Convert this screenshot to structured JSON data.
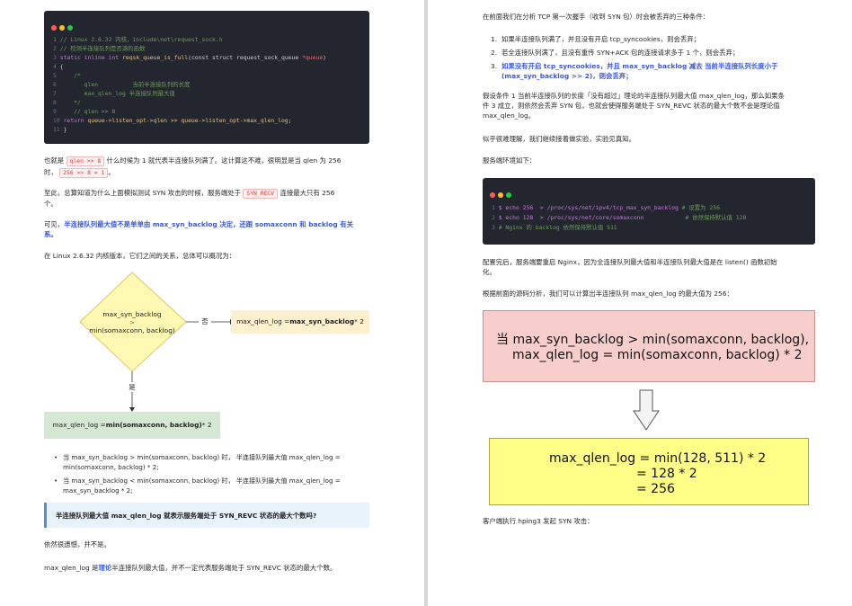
{
  "left": {
    "code": [
      {
        "n": "1",
        "text": "// Linux 2.6.32 内核，include\\net\\request_sock.h"
      },
      {
        "n": "2",
        "text": "// 检测半连接队列是否满的函数"
      },
      {
        "n": "3",
        "kw1": "static inline int",
        "fname": "reqsk_queue_is_full",
        "args_a": "(const struct request_sock_queue ",
        "args_b": "*queue",
        "args_c": ")"
      },
      {
        "n": "4",
        "text": "{"
      },
      {
        "n": "5",
        "text": "    /*"
      },
      {
        "n": "6",
        "text": "       qlen          当前半连接队列的长度"
      },
      {
        "n": "7",
        "text": "       max_qlen_log 半连接队列最大值"
      },
      {
        "n": "8",
        "text": "    */"
      },
      {
        "n": "9",
        "text": "    // qlen >> 8"
      },
      {
        "n": "10",
        "kw": "return",
        "expr": " queue->listen_opt->qlen >> queue->listen_opt->max_qlen_log;"
      },
      {
        "n": "11",
        "text": "}"
      }
    ],
    "p1_a": "也就是",
    "p1_tag1": "qlen >> 8",
    "p1_b": "什么时候为 1 就代表半连接队列满了。这计算这不难，很明显是当 qlen 为 256",
    "p1_c": "时，",
    "p1_tag2": "256 >> 8 = 1",
    "p1_d": "。",
    "p2_a": "至此，总算知道为什么上面模拟测试 SYN 攻击的时候，服务端处于",
    "p2_tag": "SYN_RECV",
    "p2_b": "连接最大只有 256",
    "p2_c": "个。",
    "p3_a": "可见，",
    "p3_b": "半连接队列最大值不是单单由 max_syn_backlog 决定，还跟 somaxconn 和 backlog 有关",
    "p3_c": "系。",
    "p4": "在 Linux 2.6.32 内核版本，它们之间的关系，总体可以概况为：",
    "flow": {
      "diamond_l1": "max_syn_backlog",
      "diamond_l2": ">",
      "diamond_l3": "min(somaxconn, backlog)",
      "no_label": "否",
      "yes_label": "是",
      "right_a": "max_qlen_log = ",
      "right_b": "max_syn_backlog",
      "right_c": " * 2",
      "bottom_a": "max_qlen_log = ",
      "bottom_b": "min(somaxconn, backlog)",
      "bottom_c": " * 2"
    },
    "bullets": [
      {
        "l1": "当 max_syn_backlog > min(somaxconn, backlog) 时， 半连接队列最大值 max_qlen_log =",
        "l2": "min(somaxconn, backlog) * 2;"
      },
      {
        "l1": "当 max_syn_backlog < min(somaxconn, backlog) 时， 半连接队列最大值 max_qlen_log =",
        "l2": "max_syn_backlog * 2;"
      }
    ],
    "callout": "半连接队列最大值 max_qlen_log 就表示服务端处于 SYN_REVC 状态的最大个数吗?",
    "p5": "依然很遗憾，并不是。",
    "p6_a": "max_qlen_log 是",
    "p6_b": "理论",
    "p6_c": "半连接队列最大值，并不一定代表服务端处于 SYN_REVC 状态的最大个数。"
  },
  "right": {
    "p1": "在前面我们在分析 TCP 第一次握手（收到 SYN 包）时会被丢弃的三种条件：",
    "list": [
      {
        "n": "1.",
        "l1": "如果半连接队列满了，并且没有开启 tcp_syncookies，则会丢弃；"
      },
      {
        "n": "2.",
        "l1": "若全连接队列满了，且没有重传 SYN+ACK 包的连接请求多于 1 个，则会丢弃；"
      },
      {
        "n": "3.",
        "l1": "如果没有开启 tcp_syncookies，并且 max_syn_backlog 减去 当前半连接队列长度小于",
        "l2": "(max_syn_backlog >> 2)，则会丢弃；"
      }
    ],
    "p2_l1": "假设条件 1 当前半连接队列的长度「没有超过」理论的半连接队列最大值 max_qlen_log，那么如果条",
    "p2_l2": "件 3 成立，则依然会丢弃 SYN 包，也就会使得服务端处于 SYN_REVC 状态的最大个数不会是理论值",
    "p2_l3": "max_qlen_log。",
    "p3": "似乎很难理解，我们继续接着做实验，实验见真知。",
    "p4": "服务端环境如下：",
    "code": [
      {
        "n": "1",
        "cmd": "$ echo 256  > /proc/sys/net/ipv4/tcp_max_syn_backlog",
        "comment": "# 设置为 256"
      },
      {
        "n": "2",
        "cmd": "$ echo 128  > /proc/sys/net/core/somaxconn",
        "comment": "# 依然保持默认值 128"
      },
      {
        "n": "3",
        "comment": "# Nginx 的 backlog 依然保持默认值 511"
      }
    ],
    "p5_l1": "配置完后，服务端要重启 Nginx，因为全连接队列最大值和半连接队列最大值是在 listen() 函数初始",
    "p5_l2": "化。",
    "p6": "根据前面的源码分析，我们可以计算出半连接队列 max_qlen_log 的最大值为 256：",
    "formula1_l1": "当 max_syn_backlog > min(somaxconn, backlog),",
    "formula1_l2": "max_qlen_log = min(somaxconn, backlog) * 2",
    "formula2_l1": "max_qlen_log = min(128, 511) * 2",
    "formula2_l2": "= 128 * 2",
    "formula2_l3": "= 256",
    "p7": "客户端执行 hping3 发起 SYN 攻击："
  }
}
